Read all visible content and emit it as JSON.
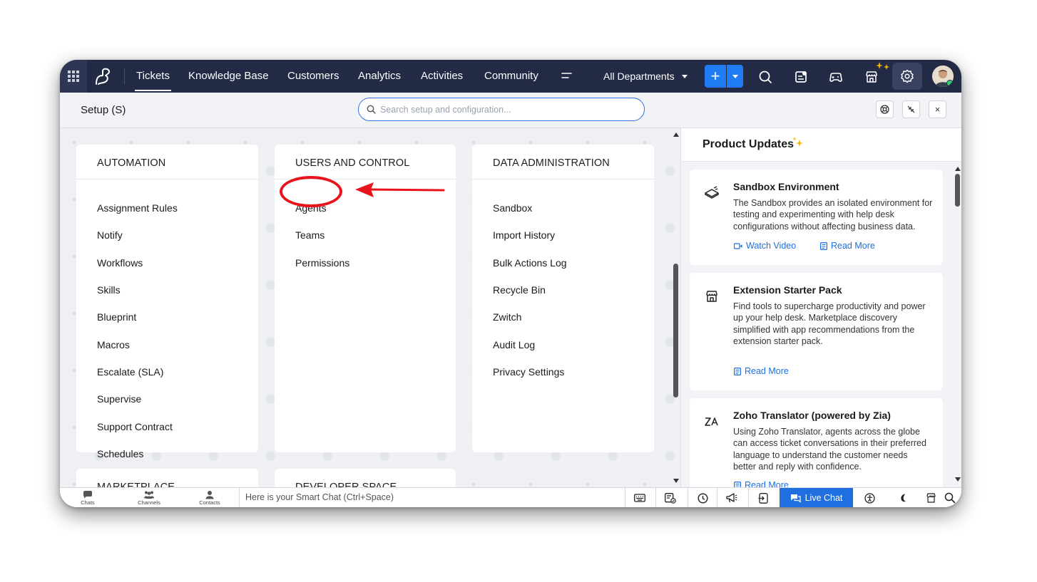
{
  "colors": {
    "nav_bg": "#222a45",
    "accent_blue": "#1f7cf2",
    "link_blue": "#1f6fe0",
    "annotation_red": "#e8141c",
    "sparkle_gold": "#f2b705"
  },
  "topnav": {
    "apps_icon": "grid-icon",
    "logo_icon": "zoho-desk-logo",
    "items": [
      {
        "label": "Tickets",
        "active": true
      },
      {
        "label": "Knowledge Base"
      },
      {
        "label": "Customers"
      },
      {
        "label": "Analytics"
      },
      {
        "label": "Activities"
      },
      {
        "label": "Community"
      }
    ],
    "department": "All Departments",
    "add_label": "+",
    "icons": [
      "search-icon",
      "feed-icon",
      "gamescope-icon",
      "marketplace-icon",
      "settings-icon",
      "avatar"
    ]
  },
  "setup": {
    "title": "Setup (S)",
    "search_placeholder": "Search setup and configuration...",
    "buttons": [
      "help-icon",
      "collapse-icon",
      "close-icon"
    ],
    "close_label": "×"
  },
  "cards": [
    {
      "title": "AUTOMATION",
      "items": [
        "Assignment Rules",
        "Notify",
        "Workflows",
        "Skills",
        "Blueprint",
        "Macros",
        "Escalate (SLA)",
        "Supervise",
        "Support Contract",
        "Schedules"
      ]
    },
    {
      "title": "USERS AND CONTROL",
      "items": [
        "Agents",
        "Teams",
        "Permissions"
      ]
    },
    {
      "title": "DATA ADMINISTRATION",
      "items": [
        "Sandbox",
        "Import History",
        "Bulk Actions Log",
        "Recycle Bin",
        "Zwitch",
        "Audit Log",
        "Privacy Settings"
      ]
    },
    {
      "title": "MARKETPLACE",
      "items": []
    },
    {
      "title": "DEVELOPER SPACE",
      "items": []
    }
  ],
  "updates": {
    "title": "Product Updates",
    "items": [
      {
        "name": "Sandbox Environment",
        "icon": "sandbox-icon",
        "desc": "The Sandbox provides an isolated environment for testing and experimenting with help desk configurations without affecting business data.",
        "links": [
          "Watch Video",
          "Read More"
        ]
      },
      {
        "name": "Extension Starter Pack",
        "icon": "store-icon",
        "desc": "Find tools to supercharge productivity and power up your help desk. Marketplace discovery simplified with app recommendations from the extension starter pack.",
        "links": [
          "Read More"
        ]
      },
      {
        "name": "Zoho Translator (powered by Zia)",
        "icon": "translate-icon",
        "desc": "Using Zoho Translator, agents across the globe can access ticket conversations in their preferred language to understand the customer needs better and reply with confidence.",
        "links": [
          "Read More"
        ]
      }
    ]
  },
  "bottombar": {
    "tabs": [
      {
        "label": "Chats"
      },
      {
        "label": "Channels"
      },
      {
        "label": "Contacts"
      }
    ],
    "smartchat": "Here is your Smart Chat (Ctrl+Space)",
    "icons": [
      "keyboard-icon",
      "task-icon",
      "clock-icon",
      "announcement-icon",
      "switch-icon"
    ],
    "livechat": "Live Chat",
    "right_icons": [
      "accessibility-icon",
      "dark-mode-icon",
      "store-icon",
      "search-icon"
    ]
  }
}
